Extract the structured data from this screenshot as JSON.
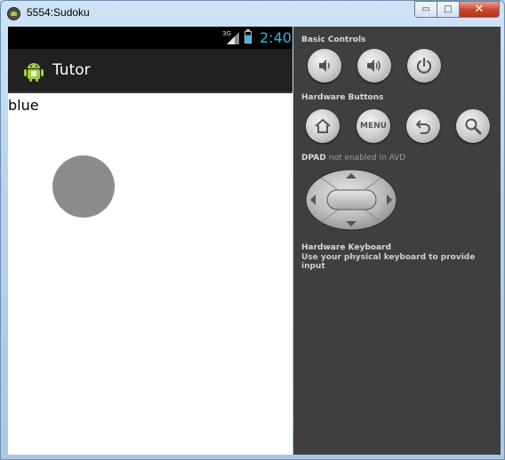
{
  "window": {
    "title": "5554:Sudoku",
    "minimize_label": "▭",
    "maximize_label": "□",
    "close_label": "✕"
  },
  "statusbar": {
    "network_label": "3G",
    "clock": "2:40",
    "clock_color": "#33b5e5"
  },
  "app": {
    "title": "Tutor",
    "icon": "android-icon",
    "content_text": "blue",
    "circle_color": "#8c8c8c"
  },
  "panel": {
    "basic_controls_label": "Basic Controls",
    "basic_controls": [
      {
        "icon": "volume-down-icon"
      },
      {
        "icon": "volume-up-icon"
      },
      {
        "icon": "power-icon"
      }
    ],
    "hardware_buttons_label": "Hardware Buttons",
    "hardware_buttons": [
      {
        "icon": "home-icon"
      },
      {
        "icon": "menu-button",
        "label": "MENU"
      },
      {
        "icon": "back-icon"
      },
      {
        "icon": "search-icon"
      }
    ],
    "dpad_label": "DPAD",
    "dpad_note": "not enabled in AVD",
    "keyboard_label": "Hardware Keyboard",
    "keyboard_note": "Use your physical keyboard to provide input"
  }
}
